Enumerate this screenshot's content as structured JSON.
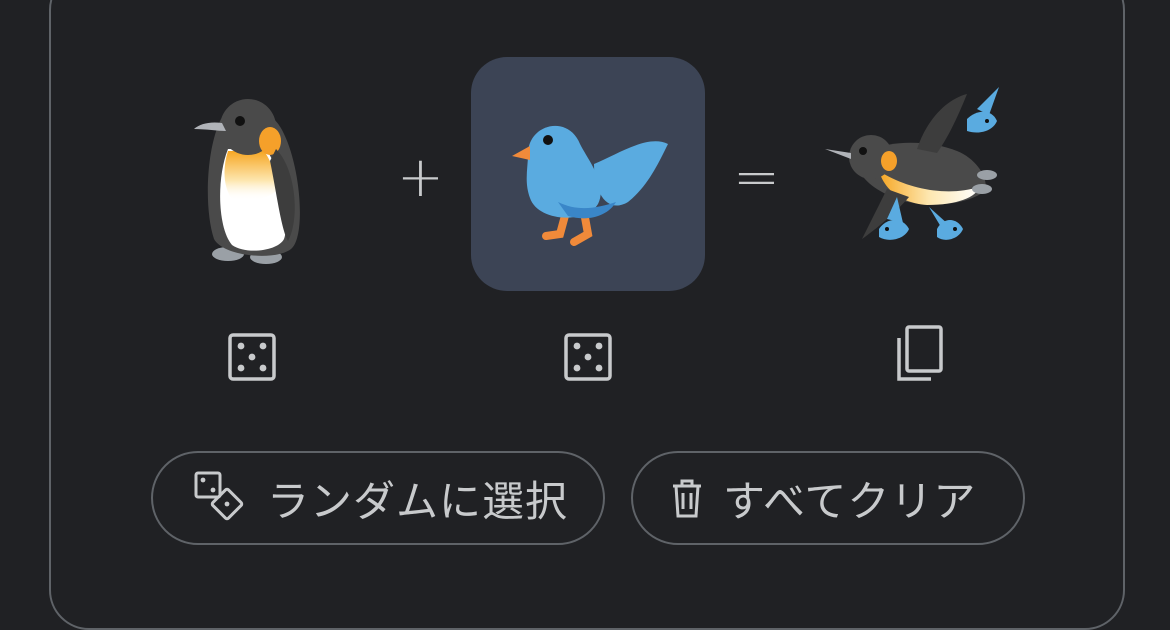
{
  "mixer": {
    "left_emoji": {
      "icon": "penguin-icon"
    },
    "right_emoji": {
      "icon": "bird-icon",
      "selected": true
    },
    "result": {
      "icon": "penguin-with-birds-icon"
    },
    "plus_sign": "+",
    "equals_sign": "="
  },
  "controls": {
    "left_random_icon": "dice-icon",
    "right_random_icon": "dice-icon",
    "copy_icon": "copy-icon"
  },
  "buttons": {
    "random_label": "ランダムに選択",
    "random_icon": "dice-pair-icon",
    "clear_label": "すべてクリア",
    "clear_icon": "trash-icon"
  },
  "colors": {
    "background": "#202124",
    "border": "#5f6368",
    "selected_slot": "#3c4455",
    "text": "#c8cacc"
  }
}
